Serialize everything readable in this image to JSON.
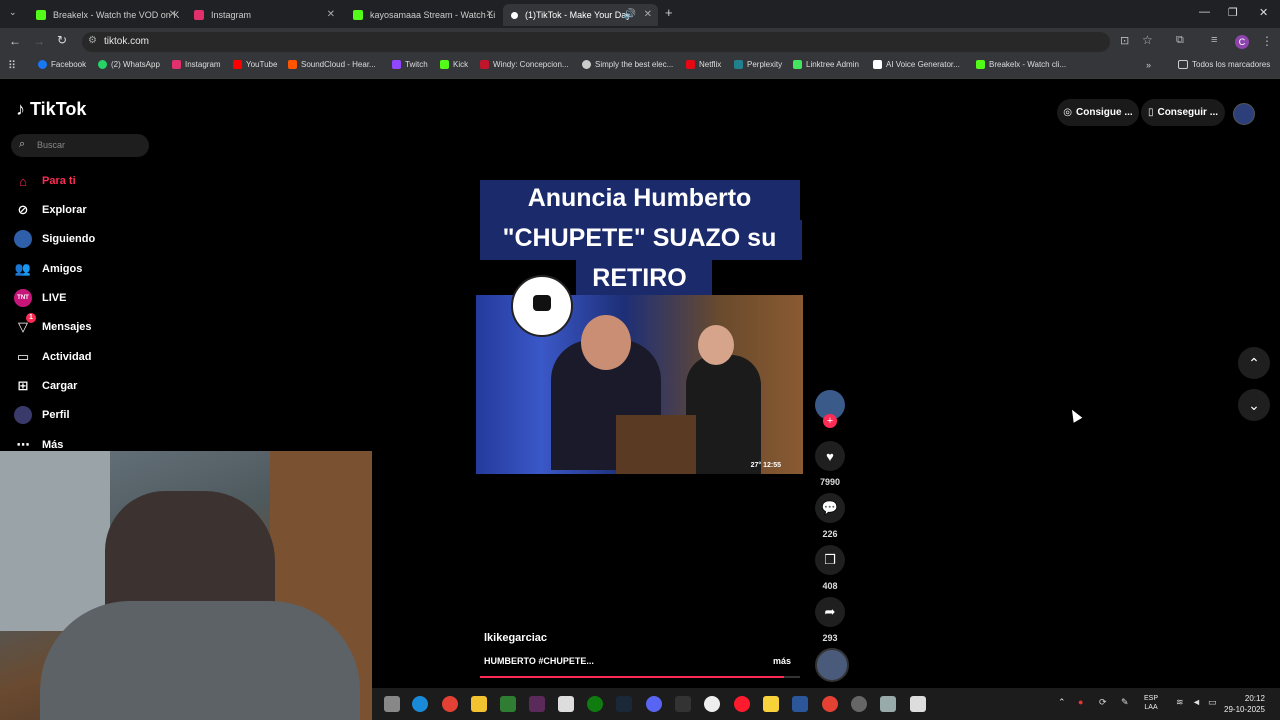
{
  "browser": {
    "tabs": [
      {
        "title": "Breakelx - Watch the VOD on K",
        "color": "#53fc18"
      },
      {
        "title": "Instagram",
        "color": "#e1306c"
      },
      {
        "title": "kayosamaaa Stream - Watch Li",
        "color": "#53fc18"
      },
      {
        "title": "(1)TikTok - Make Your Day",
        "color": "#ffffff"
      }
    ],
    "url": "tiktok.com",
    "bookmarks": [
      {
        "label": "Facebook",
        "color": "#1877f2"
      },
      {
        "label": "(2) WhatsApp",
        "color": "#25d366"
      },
      {
        "label": "Instagram",
        "color": "#e1306c"
      },
      {
        "label": "YouTube",
        "color": "#ff0000"
      },
      {
        "label": "SoundCloud - Hear...",
        "color": "#ff5500"
      },
      {
        "label": "Twitch",
        "color": "#9146ff"
      },
      {
        "label": "Kick",
        "color": "#53fc18"
      },
      {
        "label": "Windy: Concepcion...",
        "color": "#c0162b"
      },
      {
        "label": "Simply the best elec...",
        "color": "#cccccc"
      },
      {
        "label": "Netflix",
        "color": "#e50914"
      },
      {
        "label": "Perplexity",
        "color": "#20808d"
      },
      {
        "label": "Linktree Admin",
        "color": "#43e55e"
      },
      {
        "label": "AI Voice Generator...",
        "color": "#ffffff"
      },
      {
        "label": "Breakelx - Watch cli...",
        "color": "#53fc18"
      }
    ],
    "all_bookmarks": "Todos los marcadores"
  },
  "tiktok": {
    "logo": "TikTok",
    "search_placeholder": "Buscar",
    "nav": [
      {
        "label": "Para ti",
        "icon": "home-icon",
        "active": true
      },
      {
        "label": "Explorar",
        "icon": "compass-icon"
      },
      {
        "label": "Siguiendo",
        "icon": "following-avatar"
      },
      {
        "label": "Amigos",
        "icon": "friends-icon"
      },
      {
        "label": "LIVE",
        "icon": "live-icon"
      },
      {
        "label": "Mensajes",
        "icon": "inbox-icon",
        "badge": "1"
      },
      {
        "label": "Actividad",
        "icon": "activity-icon"
      },
      {
        "label": "Cargar",
        "icon": "upload-icon"
      },
      {
        "label": "Perfil",
        "icon": "profile-avatar"
      },
      {
        "label": "Más",
        "icon": "more-icon"
      }
    ],
    "get_app_1": "Consigue ...",
    "get_app_2": "Conseguir ...",
    "video": {
      "caption_line1": "Anuncia Humberto",
      "caption_line2": "\"CHUPETE\" SUAZO su",
      "caption_line3": "RETIRO",
      "overlay_time": "27° 12:55",
      "author": "lkikegarciac",
      "description": "HUMBERTO #CHUPETE...",
      "more": "más",
      "progress": 0.95
    },
    "actions": {
      "likes": "7990",
      "comments": "226",
      "saves": "408",
      "shares": "293"
    }
  },
  "taskbar": {
    "lang_line1": "ESP",
    "lang_line2": "LAA",
    "time": "20:12",
    "date": "29-10-2025"
  }
}
